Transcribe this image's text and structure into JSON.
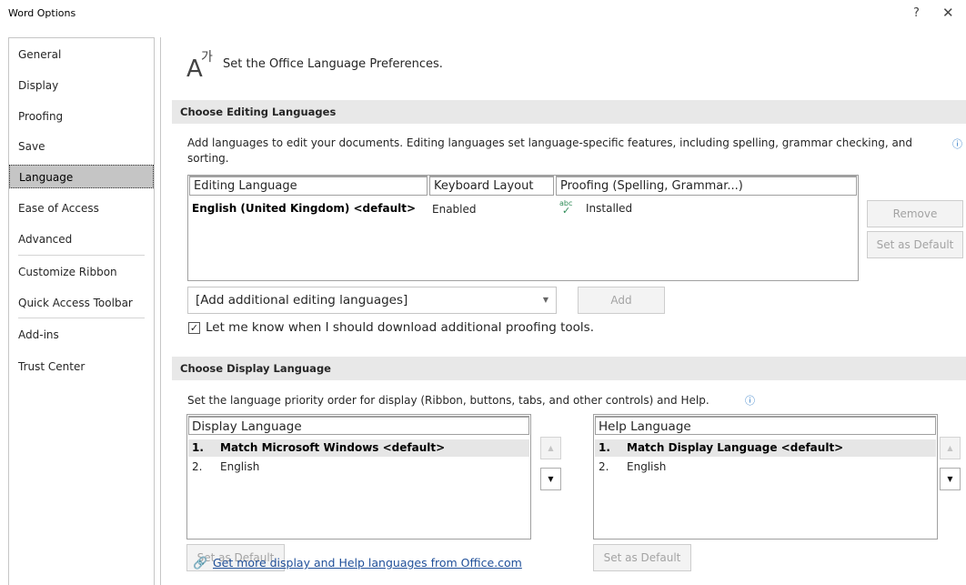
{
  "window": {
    "title": "Word Options",
    "help": "?",
    "close": "✕"
  },
  "sidebar": {
    "items": [
      {
        "label": "General"
      },
      {
        "label": "Display"
      },
      {
        "label": "Proofing"
      },
      {
        "label": "Save"
      },
      {
        "label": "Language"
      },
      {
        "label": "Ease of Access"
      },
      {
        "label": "Advanced"
      },
      {
        "label": "Customize Ribbon"
      },
      {
        "label": "Quick Access Toolbar"
      },
      {
        "label": "Add-ins"
      },
      {
        "label": "Trust Center"
      }
    ],
    "active": "Language"
  },
  "main": {
    "title": "Set the Office Language Preferences.",
    "editing": {
      "header": "Choose Editing Languages",
      "description": "Add languages to edit your documents. Editing languages set language-specific features, including spelling, grammar checking, and sorting.",
      "columns": [
        "Editing Language",
        "Keyboard Layout",
        "Proofing (Spelling, Grammar...)"
      ],
      "rows": [
        {
          "language": "English (United Kingdom) <default>",
          "keyboard": "Enabled",
          "proofing_icon": "abc",
          "proofing": "Installed"
        }
      ],
      "remove_label": "Remove",
      "set_default_label": "Set as Default",
      "add_combo_value": "[Add additional editing languages]",
      "add_label": "Add",
      "checkbox_label": "Let me know when I should download additional proofing tools.",
      "checkbox_checked": true,
      "checkmark": "✓"
    },
    "display": {
      "header": "Choose Display Language",
      "description": "Set the language priority order for display (Ribbon, buttons, tabs, and other controls) and Help.",
      "display_list": {
        "header": "Display Language",
        "items": [
          {
            "num": "1.",
            "label": "Match Microsoft Windows <default>",
            "selected": true
          },
          {
            "num": "2.",
            "label": "English",
            "selected": false
          }
        ]
      },
      "help_list": {
        "header": "Help Language",
        "items": [
          {
            "num": "1.",
            "label": "Match Display Language <default>",
            "selected": true
          },
          {
            "num": "2.",
            "label": "English",
            "selected": false
          }
        ]
      },
      "set_default_label": "Set as Default",
      "up_arrow": "▲",
      "down_arrow": "▼",
      "link_text": "Get more display and Help languages from Office.com"
    }
  },
  "colors": {
    "accent_link": "#1f4f99",
    "info_blue": "#2b78c5",
    "proofing_check": "#2e8b57"
  },
  "icons": {
    "language": "language-icon",
    "info": "info-icon",
    "link": "link-icon"
  }
}
